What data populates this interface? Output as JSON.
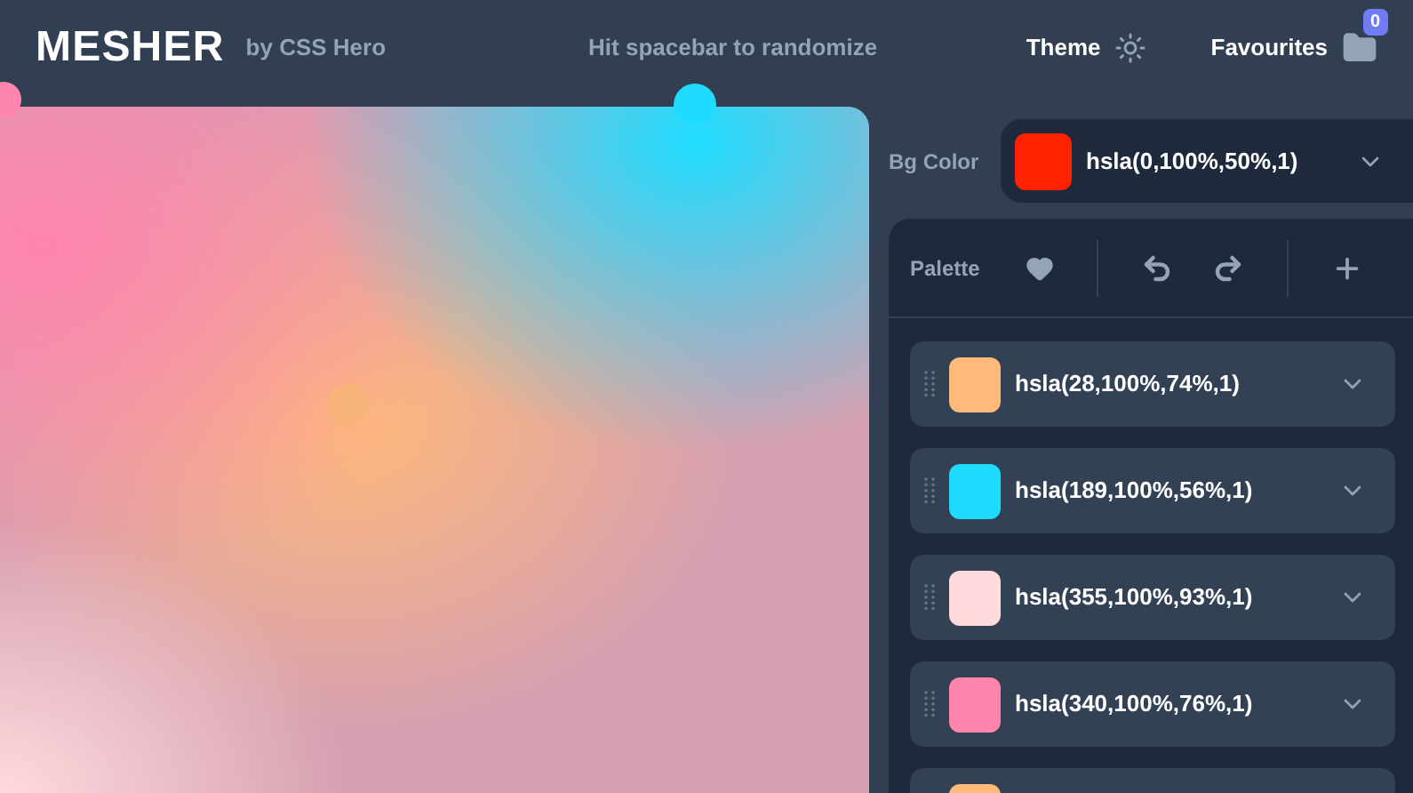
{
  "header": {
    "logo": "MESHER",
    "byline": "by CSS Hero",
    "hint": "Hit spacebar to randomize",
    "theme_label": "Theme",
    "favourites_label": "Favourites",
    "favourites_count": "0"
  },
  "bg_color": {
    "label": "Bg Color",
    "color": "#ff2200",
    "value": "hsla(0,100%,50%,1)"
  },
  "palette": {
    "label": "Palette",
    "colors": [
      {
        "color": "#ffb97a",
        "value": "hsla(28,100%,74%,1)"
      },
      {
        "color": "#1fdcff",
        "value": "hsla(189,100%,56%,1)"
      },
      {
        "color": "#ffdbde",
        "value": "hsla(355,100%,93%,1)"
      },
      {
        "color": "#ff85ad",
        "value": "hsla(340,100%,76%,1)"
      },
      {
        "color": "#ffb97a"
      }
    ]
  }
}
